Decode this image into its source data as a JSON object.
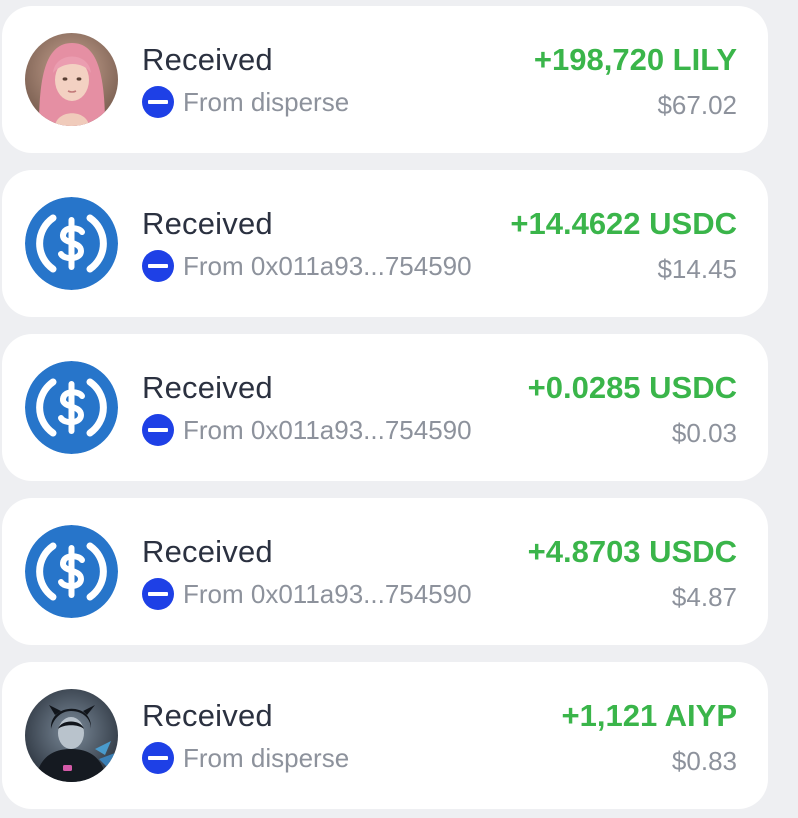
{
  "colors": {
    "background": "#eeeff2",
    "card": "#ffffff",
    "amount_green": "#3ab54a",
    "title_text": "#2b3140",
    "muted_text": "#8d929c",
    "source_badge": "#1e40e6",
    "usdc_blue": "#2775ca"
  },
  "transactions": [
    {
      "title": "Received",
      "from": "From disperse",
      "amount": "+198,720 LILY",
      "usd": "$67.02",
      "avatar": "pink-hair-girl-avatar"
    },
    {
      "title": "Received",
      "from": "From 0x011a93...754590",
      "amount": "+14.4622 USDC",
      "usd": "$14.45",
      "avatar": "usdc-icon"
    },
    {
      "title": "Received",
      "from": "From 0x011a93...754590",
      "amount": "+0.0285 USDC",
      "usd": "$0.03",
      "avatar": "usdc-icon"
    },
    {
      "title": "Received",
      "from": "From 0x011a93...754590",
      "amount": "+4.8703 USDC",
      "usd": "$4.87",
      "avatar": "usdc-icon"
    },
    {
      "title": "Received",
      "from": "From disperse",
      "amount": "+1,121 AIYP",
      "usd": "$0.83",
      "avatar": "dark-armored-character-avatar"
    }
  ]
}
